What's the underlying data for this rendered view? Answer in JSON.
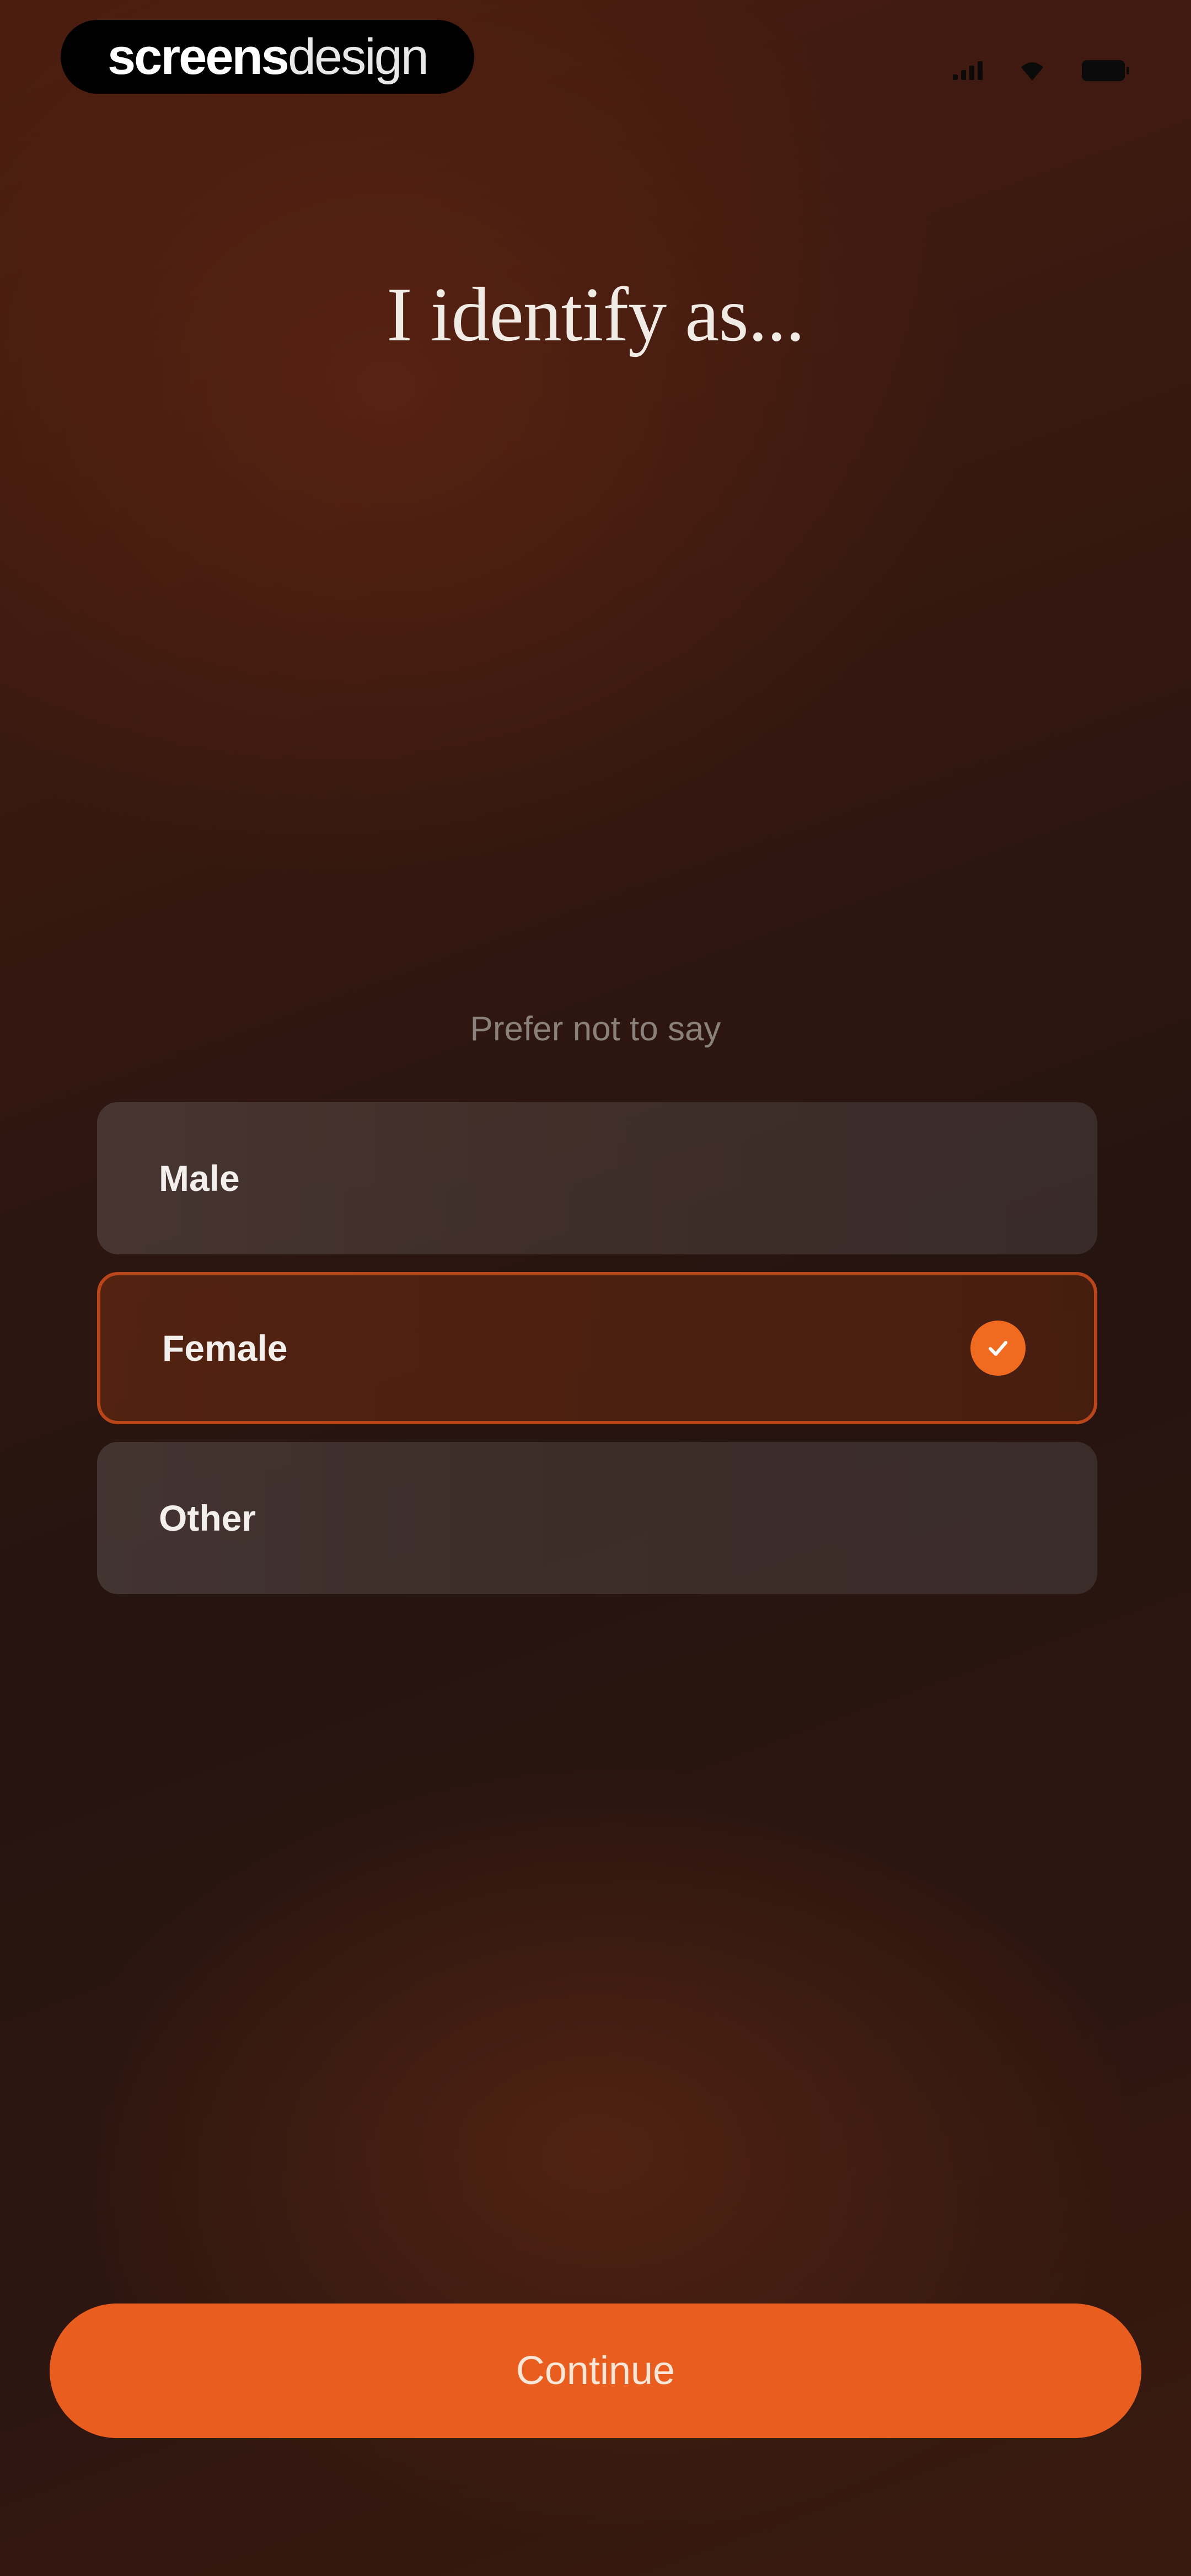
{
  "brand": {
    "bold_part": "screens",
    "light_part": "design"
  },
  "status_bar": {
    "icons": [
      "signal-icon",
      "wifi-icon",
      "battery-icon"
    ]
  },
  "title": "I identify as...",
  "prefer_not_to_say": "Prefer not to say",
  "options": [
    {
      "label": "Male",
      "selected": false
    },
    {
      "label": "Female",
      "selected": true
    },
    {
      "label": "Other",
      "selected": false
    }
  ],
  "continue_label": "Continue",
  "colors": {
    "accent": "#e95e1e",
    "selected_border": "#b8461a",
    "background_dark": "#1a0f0b"
  }
}
